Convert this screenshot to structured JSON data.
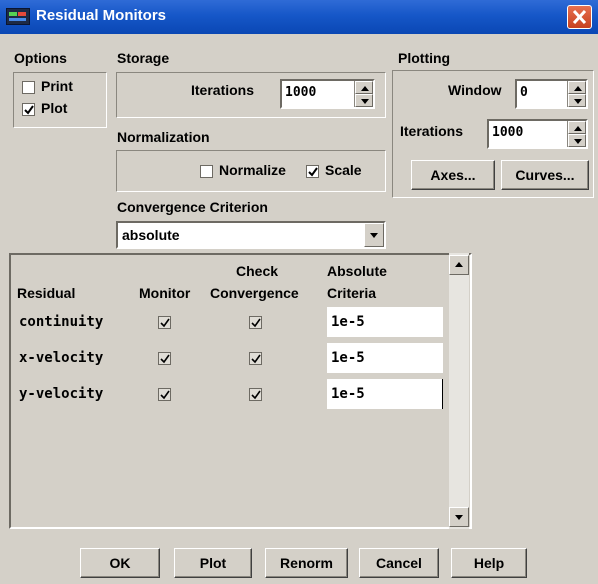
{
  "window": {
    "title": "Residual Monitors"
  },
  "options": {
    "heading": "Options",
    "print_label": "Print",
    "print_checked": false,
    "plot_label": "Plot",
    "plot_checked": true
  },
  "storage": {
    "heading": "Storage",
    "iterations_label": "Iterations",
    "iterations_value": "1000"
  },
  "plotting": {
    "heading": "Plotting",
    "window_label": "Window",
    "window_value": "0",
    "iterations_label": "Iterations",
    "iterations_value": "1000",
    "axes_button": "Axes...",
    "curves_button": "Curves..."
  },
  "normalization": {
    "heading": "Normalization",
    "normalize_label": "Normalize",
    "normalize_checked": false,
    "scale_label": "Scale",
    "scale_checked": true
  },
  "convergence": {
    "heading": "Convergence Criterion",
    "selected": "absolute"
  },
  "table": {
    "headers": {
      "residual": "Residual",
      "monitor": "Monitor",
      "check_line1": "Check",
      "check_line2": "Convergence",
      "abs_line1": "Absolute",
      "abs_line2": "Criteria"
    },
    "rows": [
      {
        "name": "continuity",
        "monitor": true,
        "check": true,
        "criteria": "1e-5"
      },
      {
        "name": "x-velocity",
        "monitor": true,
        "check": true,
        "criteria": "1e-5"
      },
      {
        "name": "y-velocity",
        "monitor": true,
        "check": true,
        "criteria": "1e-5"
      }
    ]
  },
  "buttons": {
    "ok": "OK",
    "plot": "Plot",
    "renorm": "Renorm",
    "cancel": "Cancel",
    "help": "Help"
  },
  "colors": {
    "titlebar": "#0a47b4",
    "dialog": "#d4d0c8",
    "close": "#c7401e"
  }
}
